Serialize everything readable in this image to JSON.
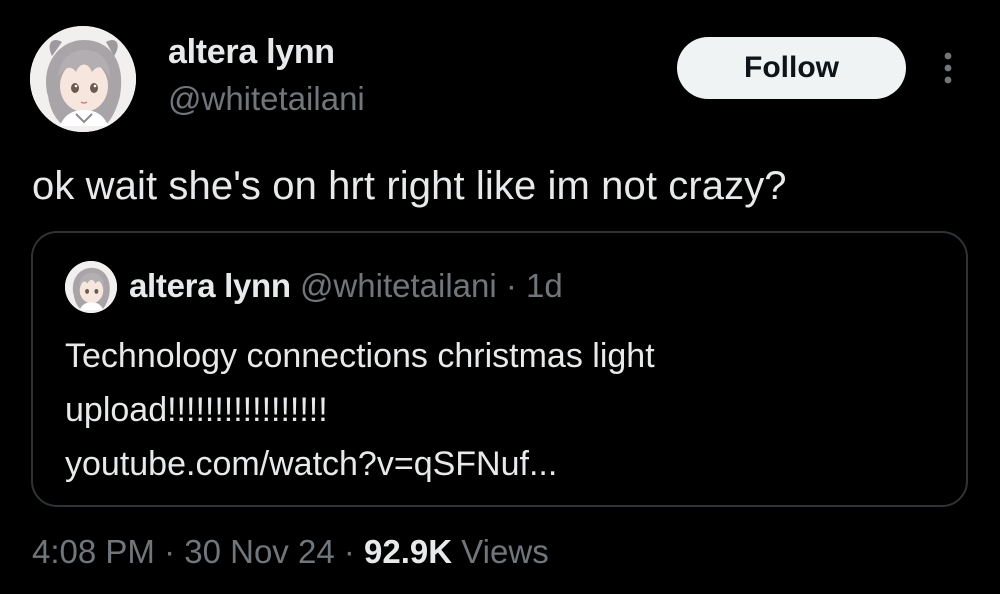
{
  "tweet": {
    "author": {
      "name": "altera lynn",
      "handle": "@whitetailani",
      "avatar_icon": "anime-girl-avatar-icon"
    },
    "follow_label": "Follow",
    "more_icon": "more-vertical-icon",
    "text": "ok wait she's on hrt right like im not crazy?",
    "quote": {
      "name": "altera lynn",
      "handle": "@whitetailani",
      "separator": "·",
      "time": "1d",
      "lines": [
        "Technology connections christmas light",
        "upload!!!!!!!!!!!!!!!!!",
        "youtube.com/watch?v=qSFNuf..."
      ]
    },
    "meta": {
      "time": "4:08 PM",
      "sep1": "·",
      "date": "30 Nov 24",
      "sep2": "·",
      "views_count": "92.9K",
      "views_label": "Views"
    }
  },
  "colors": {
    "background": "#000000",
    "primary_text": "#e7e9ea",
    "secondary_text": "#71767b",
    "border": "#2f3336",
    "follow_bg": "#eff3f4",
    "follow_text": "#0f1419"
  }
}
